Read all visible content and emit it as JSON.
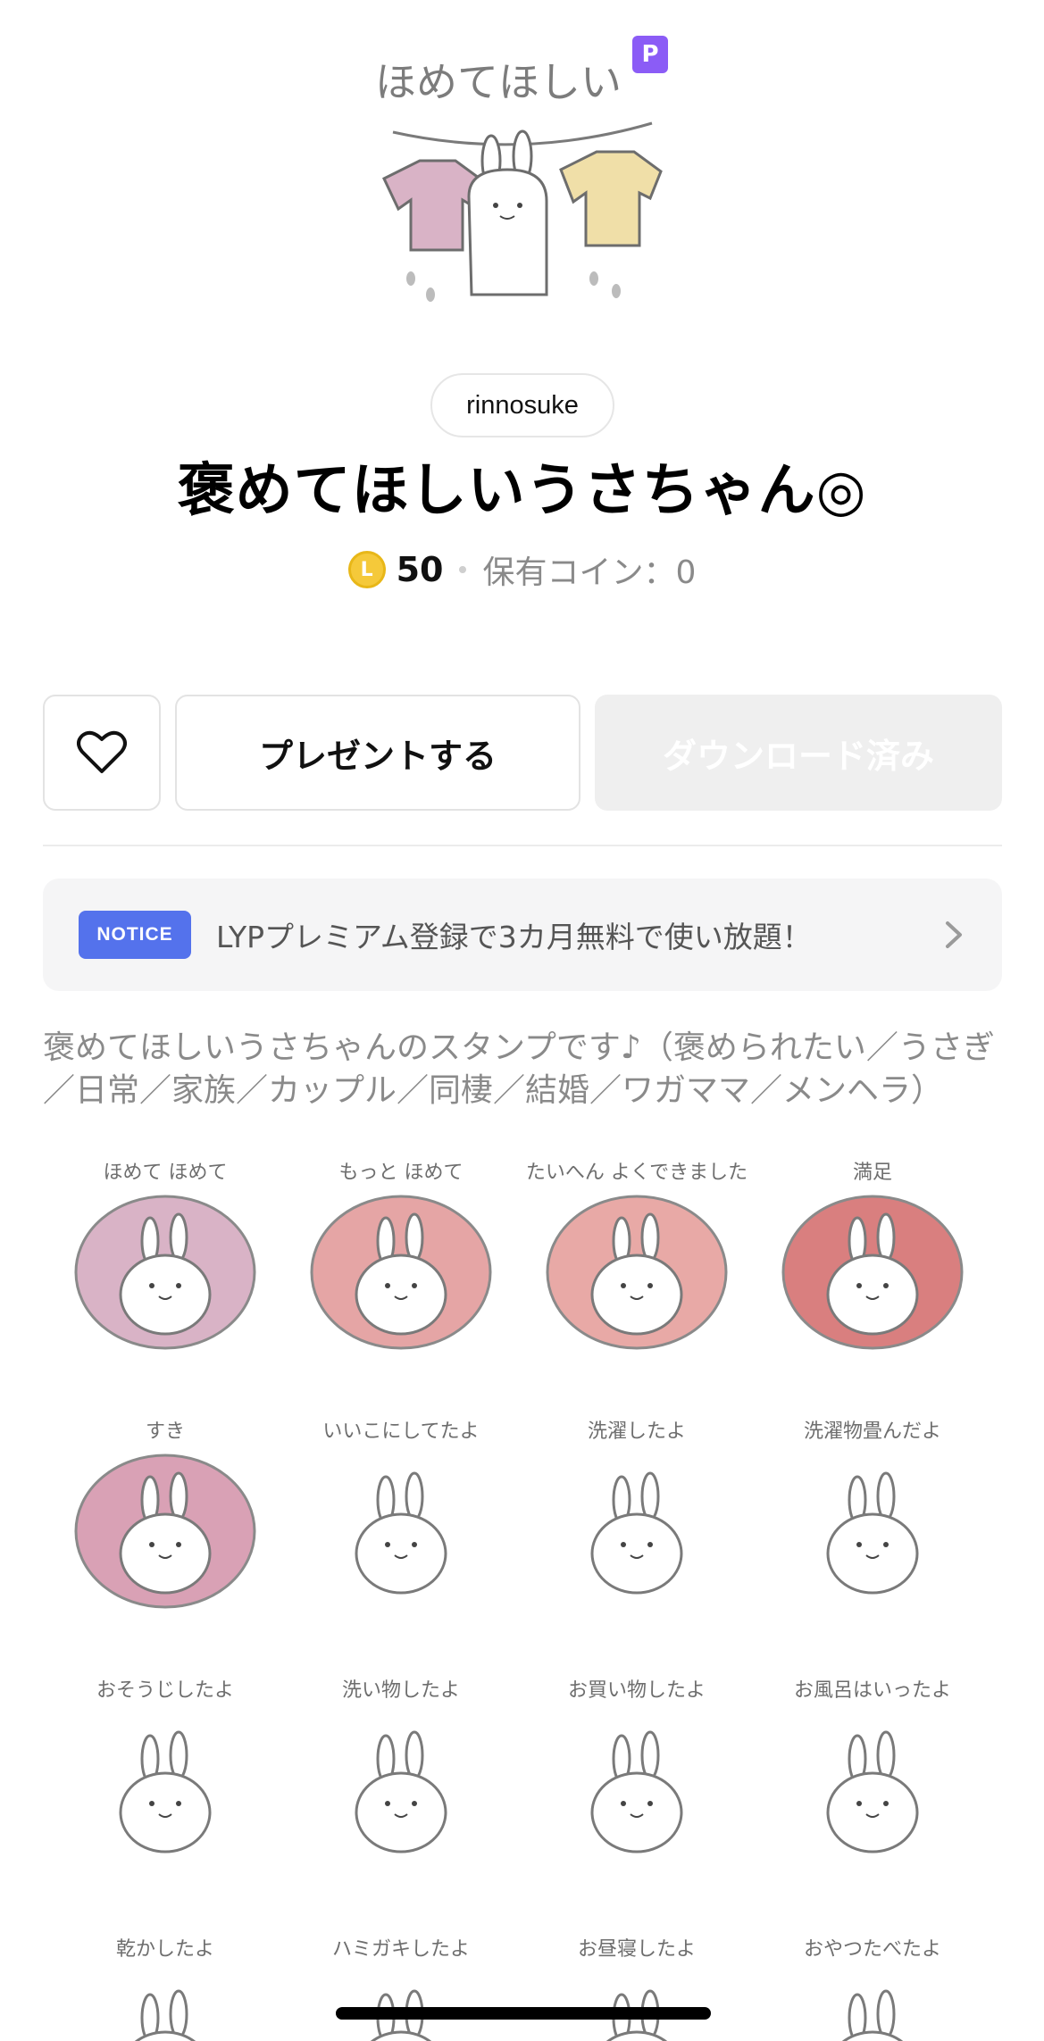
{
  "hero": {
    "premium_badge": "P",
    "icon": "sticker-main-icon"
  },
  "creator": "rinnosuke",
  "title": "褒めてほしいうさちゃん◎",
  "price": {
    "coin_icon": "L",
    "amount": "50",
    "owned": "保有コイン：0"
  },
  "actions": {
    "like_icon": "heart-icon",
    "present_label": "プレゼントする",
    "download_label": "ダウンロード済み"
  },
  "notice": {
    "badge": "NOTICE",
    "text": "LYPプレミアム登録で3カ月無料で使い放題！",
    "chevron_icon": "chevron-right-icon"
  },
  "description": "褒めてほしいうさちゃんのスタンプです♪（褒められたい／うさぎ／日常／家族／カップル／同棲／結婚／ワガママ／メンヘラ）",
  "stickers": [
    {
      "caption": "ほめて ほめて",
      "bg": "#d9b3c6"
    },
    {
      "caption": "もっと ほめて",
      "bg": "#e5a5a5"
    },
    {
      "caption": "たいへん よくできました",
      "bg": "#e8a9a6"
    },
    {
      "caption": "満足",
      "bg": "#d97f7f"
    },
    {
      "caption": "すき",
      "bg": "#d9a1b5"
    },
    {
      "caption": "いいこにしてたよ",
      "bg": "#ffffff"
    },
    {
      "caption": "洗濯したよ",
      "bg": "#ffffff"
    },
    {
      "caption": "洗濯物畳んだよ",
      "bg": "#ffffff"
    },
    {
      "caption": "おそうじしたよ",
      "bg": "#ffffff"
    },
    {
      "caption": "洗い物したよ",
      "bg": "#ffffff"
    },
    {
      "caption": "お買い物したよ",
      "bg": "#ffffff"
    },
    {
      "caption": "お風呂はいったよ",
      "bg": "#ffffff"
    },
    {
      "caption": "乾かしたよ",
      "bg": "#ffffff"
    },
    {
      "caption": "ハミガキしたよ",
      "bg": "#ffffff"
    },
    {
      "caption": "お昼寝したよ",
      "bg": "#ffffff"
    },
    {
      "caption": "おやつたべたよ",
      "bg": "#ffffff"
    }
  ],
  "colors": {
    "accent_notice": "#5472ec",
    "premium": "#8b5cf6",
    "coin": "#f5c93a"
  }
}
